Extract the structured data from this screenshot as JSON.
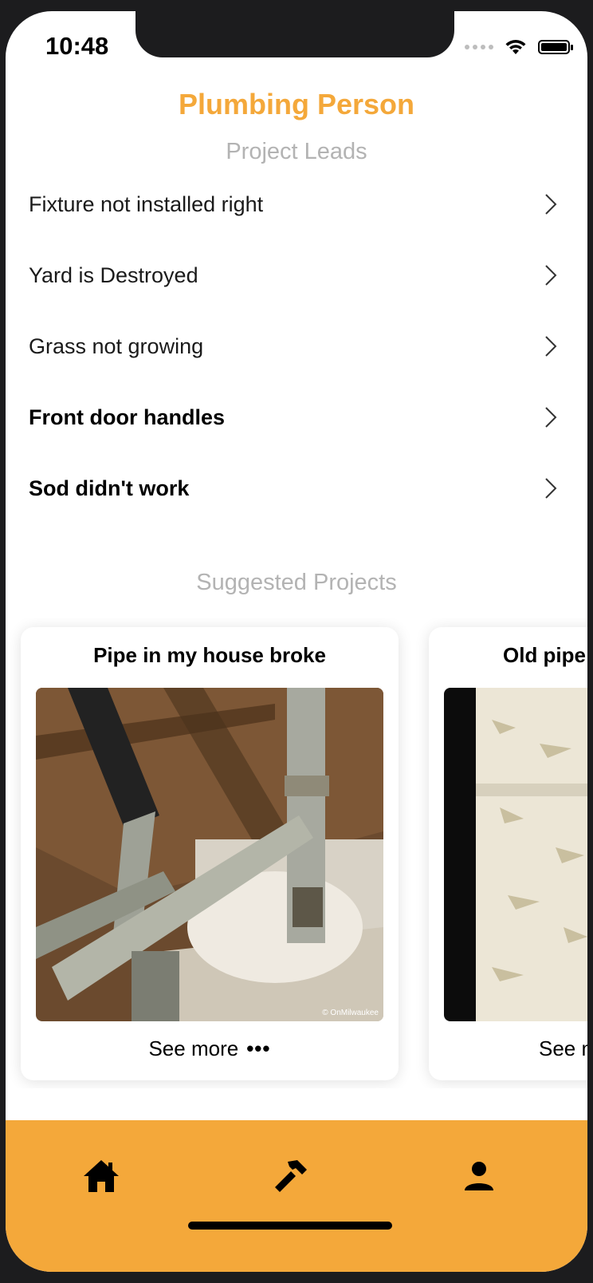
{
  "status_bar": {
    "time": "10:48"
  },
  "app": {
    "title": "Plumbing Person"
  },
  "project_leads": {
    "heading": "Project Leads",
    "items": [
      {
        "label": "Fixture not installed right",
        "unread": false
      },
      {
        "label": "Yard is Destroyed",
        "unread": false
      },
      {
        "label": "Grass not growing",
        "unread": false
      },
      {
        "label": "Front door handles",
        "unread": true
      },
      {
        "label": "Sod didn't work",
        "unread": true
      }
    ]
  },
  "suggested_projects": {
    "heading": "Suggested Projects",
    "cards": [
      {
        "title": "Pipe in my house broke",
        "see_more": "See more",
        "more_icon": "•••",
        "image_watermark": "© OnMilwaukee"
      },
      {
        "title": "Old pipe",
        "see_more": "See more",
        "more_icon": "•••"
      }
    ]
  },
  "tab_bar": {
    "tabs": [
      {
        "icon": "home-icon"
      },
      {
        "icon": "hammer-icon"
      },
      {
        "icon": "person-icon"
      }
    ]
  },
  "colors": {
    "accent": "#f4a83a",
    "muted": "#b3b3b3"
  }
}
